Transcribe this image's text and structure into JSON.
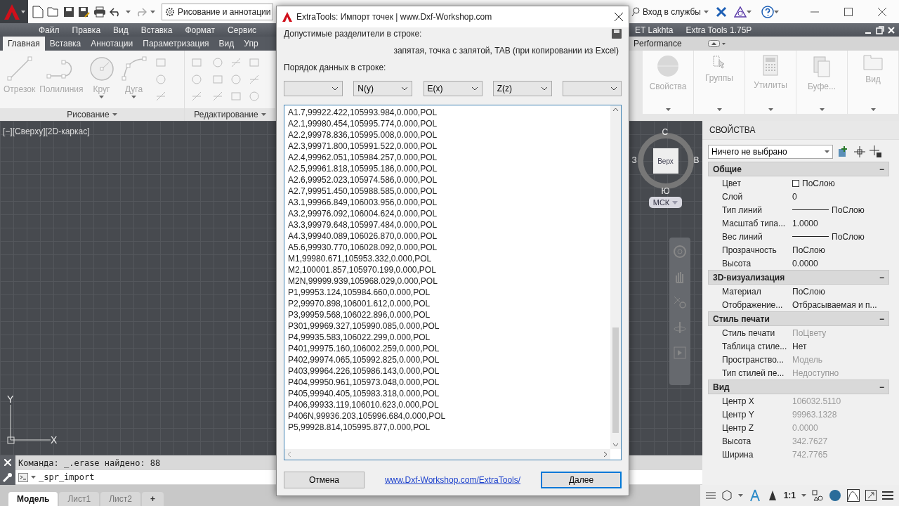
{
  "app": {
    "workspace": "Рисование и аннотации",
    "sign_in": "Вход в службы"
  },
  "menu_left": [
    "Файл",
    "Правка",
    "Вид",
    "Вставка",
    "Формат",
    "Сервис"
  ],
  "menu_right": [
    "ET Lakhta",
    "Extra Tools 1.75P"
  ],
  "ribbon_tabs_left": [
    {
      "label": "Главная",
      "selected": true
    },
    {
      "label": "Вставка",
      "selected": false
    },
    {
      "label": "Аннотации",
      "selected": false
    },
    {
      "label": "Параметризация",
      "selected": false
    },
    {
      "label": "Вид",
      "selected": false
    },
    {
      "label": "Упр",
      "selected": false
    }
  ],
  "ribbon_tabs_right": [
    {
      "label": "Performance",
      "selected": false
    }
  ],
  "ribbon_panels_left": [
    {
      "title": "Рисование",
      "tools": [
        {
          "label": "Отрезок",
          "kind": "line",
          "dropdown": false
        },
        {
          "label": "Полилиния",
          "kind": "polyline",
          "dropdown": false
        },
        {
          "label": "Круг",
          "kind": "circle",
          "dropdown": true
        },
        {
          "label": "Дуга",
          "kind": "arc",
          "dropdown": true
        }
      ]
    },
    {
      "title": "Редактирование"
    }
  ],
  "ribbon_panels_right": [
    {
      "label": "Свойства",
      "kind": "properties"
    },
    {
      "label": "Группы",
      "kind": "groups"
    },
    {
      "label": "Утилиты",
      "kind": "calculator"
    },
    {
      "label": "Буфе...",
      "kind": "clipboard"
    },
    {
      "label": "Вид",
      "kind": "view"
    }
  ],
  "viewport": {
    "label": "[−][Сверху][2D-каркас]",
    "axis_x": "X",
    "axis_y": "Y",
    "viewcube": {
      "north": "С",
      "east": "В",
      "south": "Ю",
      "west": "З",
      "face": "Верх",
      "ucs": "МСК"
    }
  },
  "command_line": {
    "history": "Команда: _.erase найдено: 88",
    "input": "_spr_import"
  },
  "layout_tabs": [
    {
      "label": "Модель",
      "selected": true
    },
    {
      "label": "Лист1",
      "selected": false
    },
    {
      "label": "Лист2",
      "selected": false
    }
  ],
  "new_layout": "+",
  "status_bar": {
    "scale": "1:1"
  },
  "properties": {
    "title": "СВОЙСТВА",
    "selection": "Ничего не выбрано",
    "sections": [
      {
        "title": "Общие",
        "toggle": "−",
        "rows": [
          {
            "label": "Цвет",
            "value": "ПоСлою",
            "kind": "color",
            "disabled": false
          },
          {
            "label": "Слой",
            "value": "0",
            "kind": "text",
            "disabled": false
          },
          {
            "label": "Тип линий",
            "value": "ПоСлою",
            "kind": "line",
            "disabled": false
          },
          {
            "label": "Масштаб типа...",
            "value": "1.0000",
            "kind": "text",
            "disabled": false
          },
          {
            "label": "Вес линий",
            "value": "ПоСлою",
            "kind": "line",
            "disabled": false
          },
          {
            "label": "Прозрачность",
            "value": "ПоСлою",
            "kind": "text",
            "disabled": false
          },
          {
            "label": "Высота",
            "value": "0.0000",
            "kind": "text",
            "disabled": false
          }
        ]
      },
      {
        "title": "3D-визуализация",
        "toggle": "−",
        "rows": [
          {
            "label": "Материал",
            "value": "ПоСлою",
            "kind": "text",
            "disabled": false
          },
          {
            "label": "Отображение...",
            "value": "Отбрасываемая и п...",
            "kind": "text",
            "disabled": false
          }
        ]
      },
      {
        "title": "Стиль печати",
        "toggle": "−",
        "rows": [
          {
            "label": "Стиль печати",
            "value": "ПоЦвету",
            "kind": "text",
            "disabled": true
          },
          {
            "label": "Таблица стиле...",
            "value": "Нет",
            "kind": "text",
            "disabled": false
          },
          {
            "label": "Пространство...",
            "value": "Модель",
            "kind": "text",
            "disabled": true
          },
          {
            "label": "Тип стилей пе...",
            "value": "Недоступно",
            "kind": "text",
            "disabled": true
          }
        ]
      },
      {
        "title": "Вид",
        "toggle": "−",
        "rows": [
          {
            "label": "Центр X",
            "value": "106032.5110",
            "kind": "text",
            "disabled": true
          },
          {
            "label": "Центр Y",
            "value": "99963.1328",
            "kind": "text",
            "disabled": true
          },
          {
            "label": "Центр Z",
            "value": "0.0000",
            "kind": "text",
            "disabled": true
          },
          {
            "label": "Высота",
            "value": "342.7627",
            "kind": "text",
            "disabled": true
          },
          {
            "label": "Ширина",
            "value": "742.7765",
            "kind": "text",
            "disabled": true
          }
        ]
      }
    ]
  },
  "dialog": {
    "title": "ExtraTools: Импорт точек | www.Dxf-Workshop.com",
    "separators_label": "Допустимые разделители в строке:",
    "separators": "запятая, точка с запятой, TAB (при копировании из Excel)",
    "order_label": "Порядок данных в строке:",
    "columns": [
      {
        "kind": "empty"
      },
      {
        "kind": "filled",
        "value": "N(y)"
      },
      {
        "kind": "filled",
        "value": "E(x)"
      },
      {
        "kind": "filled",
        "value": "Z(z)"
      },
      {
        "kind": "empty"
      }
    ],
    "lines": [
      "A1.7,99922.422,105993.984,0.000,POL",
      "A2.1,99980.454,105995.774,0.000,POL",
      "A2.2,99978.836,105995.008,0.000,POL",
      "A2.3,99971.800,105991.522,0.000,POL",
      "A2.4,99962.051,105984.257,0.000,POL",
      "A2.5,99961.818,105995.186,0.000,POL",
      "A2.6,99952.023,105974.586,0.000,POL",
      "A2.7,99951.450,105988.585,0.000,POL",
      "A3.1,99966.849,106003.956,0.000,POL",
      "A3.2,99976.092,106004.624,0.000,POL",
      "A3.3,99979.648,105997.484,0.000,POL",
      "A4.3,99940.089,106026.870,0.000,POL",
      "A5.6,99930.770,106028.092,0.000,POL",
      "M1,99980.671,105953.332,0.000,POL",
      "M2,100001.857,105970.199,0.000,POL",
      "M2N,99999.939,105968.029,0.000,POL",
      "P1,99953.124,105984.660,0.000,POL",
      "P2,99970.898,106001.612,0.000,POL",
      "P3,99959.568,106022.896,0.000,POL",
      "P301,99969.327,105990.085,0.000,POL",
      "P4,99935.583,106022.299,0.000,POL",
      "P401,99975.160,106002.259,0.000,POL",
      "P402,99974.065,105992.825,0.000,POL",
      "P403,99964.226,105986.143,0.000,POL",
      "P404,99950.961,105973.048,0.000,POL",
      "P405,99940.405,105983.318,0.000,POL",
      "P406,99933.119,106010.623,0.000,POL",
      "P406N,99936.203,105996.684,0.000,POL",
      "P5,99928.814,105995.877,0.000,POL"
    ],
    "cancel": "Отмена",
    "link": "www.Dxf-Workshop.com/ExtraTools/",
    "next": "Далее"
  }
}
